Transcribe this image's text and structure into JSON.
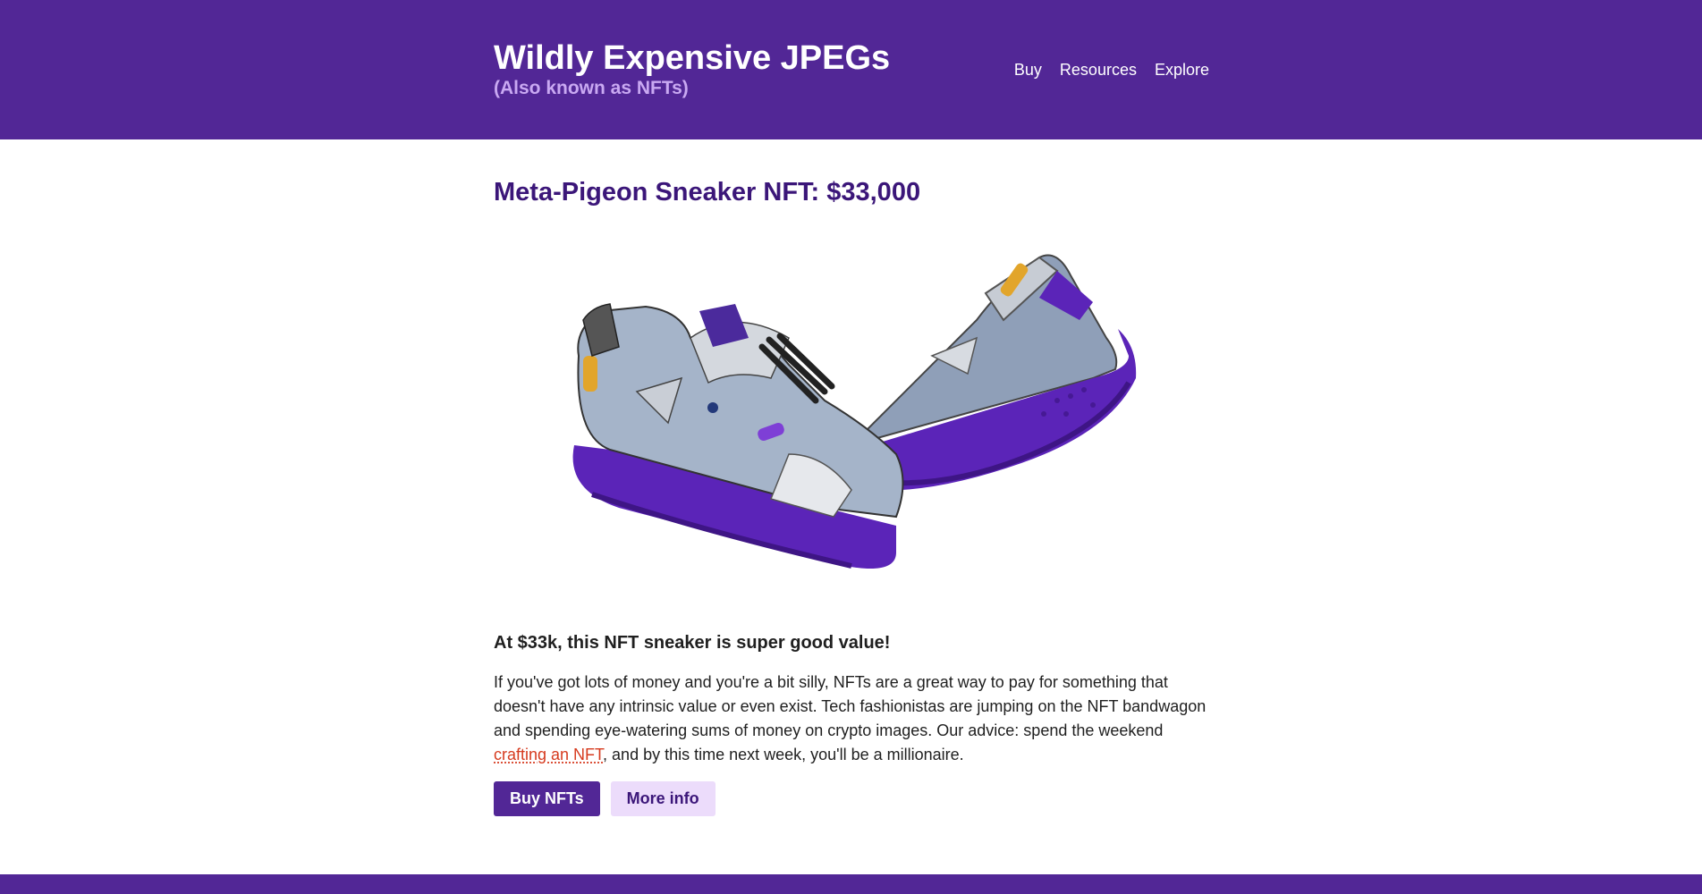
{
  "header": {
    "title": "Wildly Expensive JPEGs",
    "subtitle": "(Also known as NFTs)",
    "nav": [
      {
        "label": "Buy"
      },
      {
        "label": "Resources"
      },
      {
        "label": "Explore"
      }
    ]
  },
  "main": {
    "heading": "Meta-Pigeon Sneaker NFT: $33,000",
    "tagline": "At $33k, this NFT sneaker is super good value!",
    "paragraph_before_link": "If you've got lots of money and you're a bit silly, NFTs are a great way to pay for something that doesn't have any intrinsic value or even exist. Tech fashionistas are jumping on the NFT bandwagon and spending eye-watering sums of money on crypto images. Our advice: spend the weekend ",
    "paragraph_link": "crafting an NFT",
    "paragraph_after_link": ", and by this time next week, you'll be a millionaire.",
    "buttons": {
      "primary": "Buy NFTs",
      "secondary": "More info"
    }
  },
  "colors": {
    "brand_purple": "#522796",
    "heading_purple": "#3b1679",
    "subtitle_lilac": "#c9a9f2",
    "secondary_button_bg": "#ecdcfb",
    "link_red": "#d63a1e",
    "sneaker_sole": "#5b24b8"
  }
}
